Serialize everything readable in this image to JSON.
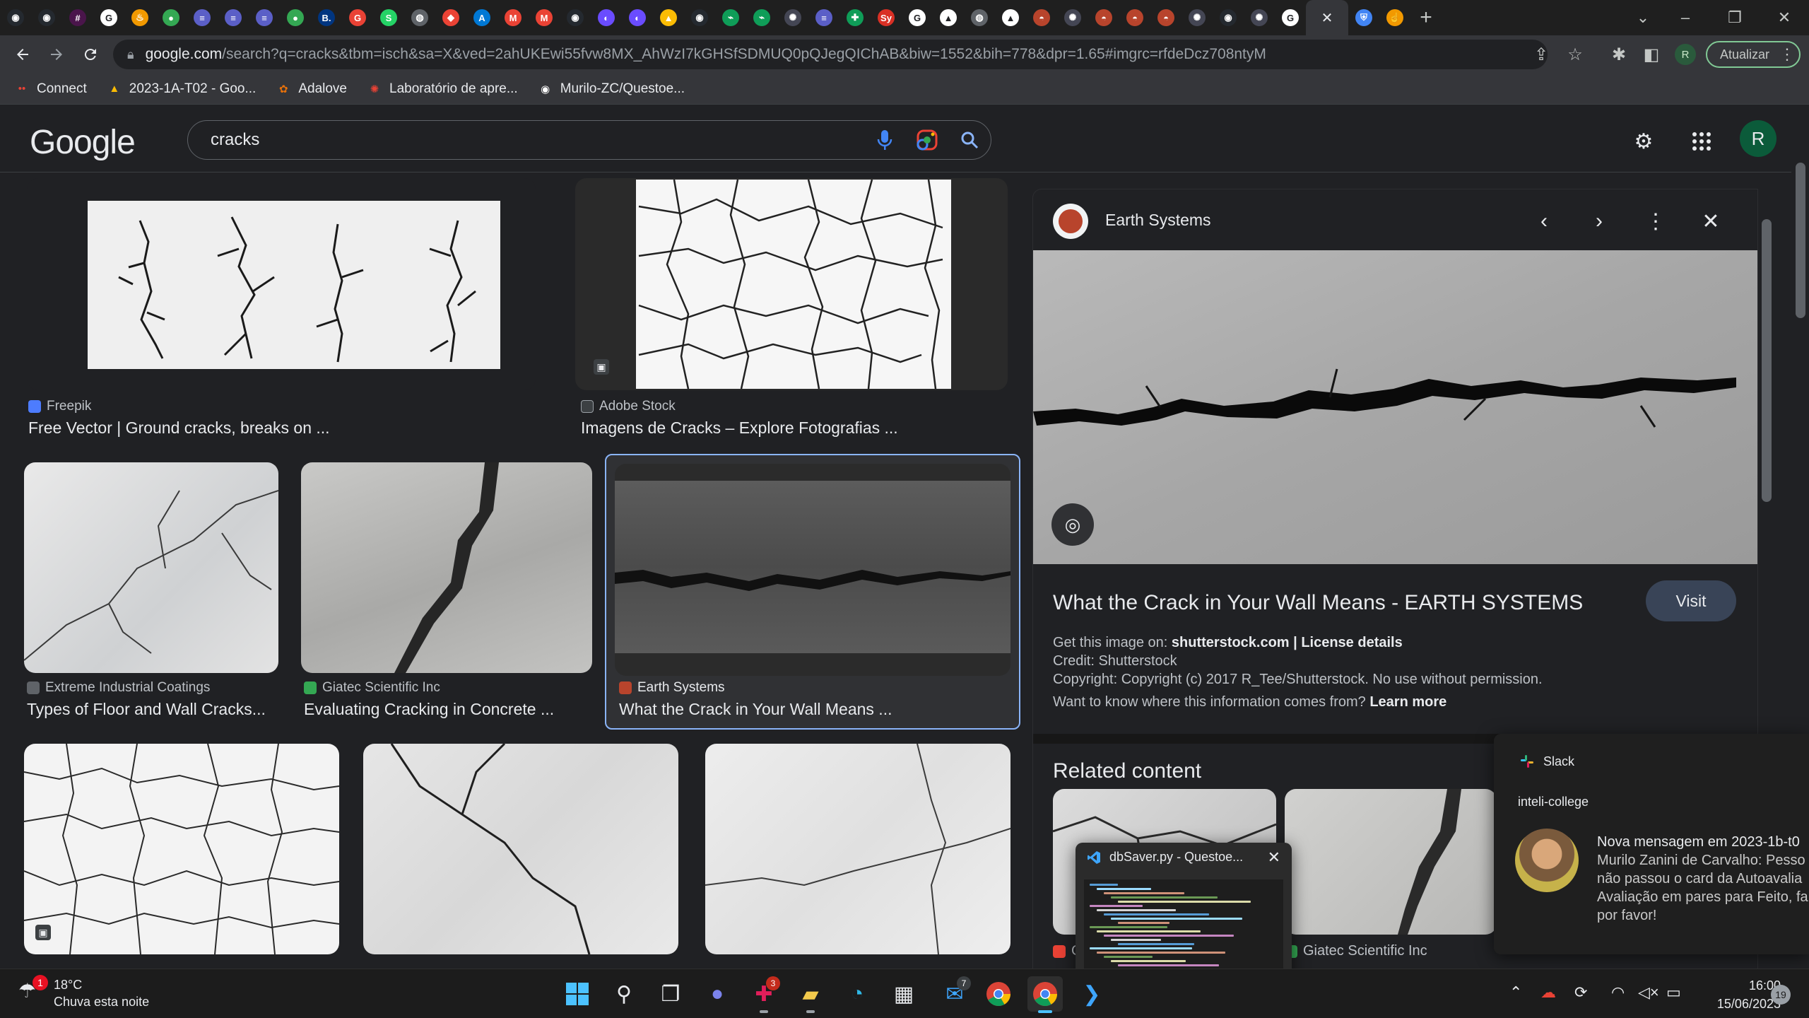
{
  "browser": {
    "tabs": [
      {
        "icon": "github-icon",
        "color": "#24292f",
        "glyph": "◉"
      },
      {
        "icon": "github-icon",
        "color": "#24292f",
        "glyph": "◉"
      },
      {
        "icon": "slack-icon",
        "color": "#4a154b",
        "glyph": "#"
      },
      {
        "icon": "google-icon",
        "color": "#ffffff",
        "glyph": "G"
      },
      {
        "icon": "flame-icon",
        "color": "#f29900",
        "glyph": "♨"
      },
      {
        "icon": "pin-icon",
        "color": "#34a853",
        "glyph": "●"
      },
      {
        "icon": "list-icon",
        "color": "#5b5fc7",
        "glyph": "≡"
      },
      {
        "icon": "list-icon",
        "color": "#5b5fc7",
        "glyph": "≡"
      },
      {
        "icon": "list-icon",
        "color": "#5b5fc7",
        "glyph": "≡"
      },
      {
        "icon": "pin-icon",
        "color": "#34a853",
        "glyph": "●"
      },
      {
        "icon": "booking-icon",
        "color": "#003580",
        "glyph": "B."
      },
      {
        "icon": "g-red-icon",
        "color": "#e94235",
        "glyph": "G"
      },
      {
        "icon": "whatsapp-icon",
        "color": "#25d366",
        "glyph": "S"
      },
      {
        "icon": "globe-icon",
        "color": "#5f6368",
        "glyph": "◍"
      },
      {
        "icon": "maps-icon",
        "color": "#ea4335",
        "glyph": "◆"
      },
      {
        "icon": "azure-icon",
        "color": "#0078d4",
        "glyph": "A"
      },
      {
        "icon": "gmail-icon",
        "color": "#ea4335",
        "glyph": "M"
      },
      {
        "icon": "gmail-icon",
        "color": "#ea4335",
        "glyph": "M"
      },
      {
        "icon": "github-icon",
        "color": "#24292f",
        "glyph": "◉"
      },
      {
        "icon": "moon-icon",
        "color": "#6a4cff",
        "glyph": "◐"
      },
      {
        "icon": "moon-icon",
        "color": "#6a4cff",
        "glyph": "◐"
      },
      {
        "icon": "drive-icon",
        "color": "#fbbc04",
        "glyph": "▲"
      },
      {
        "icon": "github-icon",
        "color": "#24292f",
        "glyph": "◉"
      },
      {
        "icon": "activity-icon",
        "color": "#0f9d58",
        "glyph": "⌁"
      },
      {
        "icon": "activity-icon",
        "color": "#0f9d58",
        "glyph": "⌁"
      },
      {
        "icon": "openai-icon",
        "color": "#444654",
        "glyph": "✺"
      },
      {
        "icon": "list-icon",
        "color": "#5b5fc7",
        "glyph": "≡"
      },
      {
        "icon": "sheets-icon",
        "color": "#0f9d58",
        "glyph": "✚"
      },
      {
        "icon": "sy-icon",
        "color": "#d93025",
        "glyph": "Sy"
      },
      {
        "icon": "google-icon",
        "color": "#ffffff",
        "glyph": "G"
      },
      {
        "icon": "notion-icon",
        "color": "#ffffff",
        "glyph": "▲"
      },
      {
        "icon": "globe-icon",
        "color": "#5f6368",
        "glyph": "◍"
      },
      {
        "icon": "notion-icon",
        "color": "#ffffff",
        "glyph": "▲"
      },
      {
        "icon": "earth-systems-icon",
        "color": "#b8442c",
        "glyph": "◓"
      },
      {
        "icon": "openai-icon",
        "color": "#444654",
        "glyph": "✺"
      },
      {
        "icon": "earth-systems-icon",
        "color": "#b8442c",
        "glyph": "◓"
      },
      {
        "icon": "earth-systems-icon",
        "color": "#b8442c",
        "glyph": "◓"
      },
      {
        "icon": "earth-systems-icon",
        "color": "#b8442c",
        "glyph": "◓"
      },
      {
        "icon": "openai-icon",
        "color": "#444654",
        "glyph": "✺"
      },
      {
        "icon": "github-icon",
        "color": "#24292f",
        "glyph": "◉"
      },
      {
        "icon": "openai-icon",
        "color": "#444654",
        "glyph": "✺"
      },
      {
        "icon": "google-icon",
        "color": "#ffffff",
        "glyph": "G"
      }
    ],
    "active_tab_close": "✕",
    "after_tabs": [
      {
        "icon": "shield-icon",
        "color": "#4285f4",
        "glyph": "⛨"
      },
      {
        "icon": "hand-icon",
        "color": "#f29900",
        "glyph": "☝"
      }
    ],
    "new_tab": "+",
    "window": {
      "minimize": "–",
      "restore": "❐",
      "close": "✕",
      "tab_search": "⌄"
    },
    "url_host": "google.com",
    "url_rest": "/search?q=cracks&tbm=isch&sa=X&ved=2ahUKEwi55fvw8MX_AhWzI7kGHSfSDMUQ0pQJegQIChAB&biw=1552&bih=778&dpr=1.65#imgrc=rfdeDcz708ntyM",
    "profile_initial": "R",
    "update_label": "Atualizar",
    "bookmarks": [
      {
        "label": "Connect",
        "icon": "connect-icon",
        "color": "#e94235",
        "glyph": "••"
      },
      {
        "label": "2023-1A-T02 - Goo...",
        "icon": "drive-icon",
        "color": "#fbbc04",
        "glyph": "▲"
      },
      {
        "label": "Adalove",
        "icon": "adalove-icon",
        "color": "#e8710a",
        "glyph": "✿"
      },
      {
        "label": "Laboratório de apre...",
        "icon": "lab-icon",
        "color": "#e94235",
        "glyph": "✺"
      },
      {
        "label": "Murilo-ZC/Questoe...",
        "icon": "github-icon",
        "color": "#ffffff",
        "glyph": "◉"
      }
    ]
  },
  "google": {
    "logo": "Google",
    "query": "cracks",
    "avatar_initial": "R"
  },
  "results": [
    {
      "source": "Freepik",
      "title": "Free Vector | Ground cracks, breaks on ...",
      "src_color": "#4d7cfe"
    },
    {
      "source": "Adobe Stock",
      "title": "Imagens de Cracks – Explore Fotografias ...",
      "src_color": "#3c4043"
    },
    {
      "source": "Extreme Industrial Coatings",
      "title": "Types of Floor and Wall Cracks...",
      "src_color": "#5f6368"
    },
    {
      "source": "Giatec Scientific Inc",
      "title": "Evaluating Cracking in Concrete ...",
      "src_color": "#34a853"
    },
    {
      "source": "Earth Systems",
      "title": "What the Crack in Your Wall Means ...",
      "src_color": "#b8442c"
    }
  ],
  "panel": {
    "site": "Earth Systems",
    "title": "What the Crack in Your Wall Means - EARTH SYSTEMS",
    "visit": "Visit",
    "get_image_prefix": "Get this image on: ",
    "get_image_site": "shutterstock.com",
    "separator": " | ",
    "license": "License details",
    "credit": "Credit: Shutterstock",
    "copyright": "Copyright: Copyright (c) 2017 R_Tee/Shutterstock. No use without permission.",
    "want_to_know": "Want to know where this information comes from? ",
    "learn_more": "Learn more",
    "related_heading": "Related content",
    "related_sources": [
      "G",
      "Giatec Scientific Inc"
    ]
  },
  "slack": {
    "app": "Slack",
    "workspace": "inteli-college",
    "heading": "Nova mensagem em 2023-1b-t0",
    "lines": [
      "Murilo Zanini de Carvalho: Pesso",
      "não passou o card da Autoavalia",
      "Avaliação em pares para Feito, fa",
      "por favor!"
    ]
  },
  "vscode_preview": {
    "title": "dbSaver.py - Questoe..."
  },
  "taskbar": {
    "weather_temp": "18°C",
    "weather_desc": "Chuva esta noite",
    "weather_badge": "1",
    "teams_badge": "3",
    "mail_badge": "7",
    "time": "16:00",
    "date": "15/06/2023",
    "notifications": "19"
  }
}
